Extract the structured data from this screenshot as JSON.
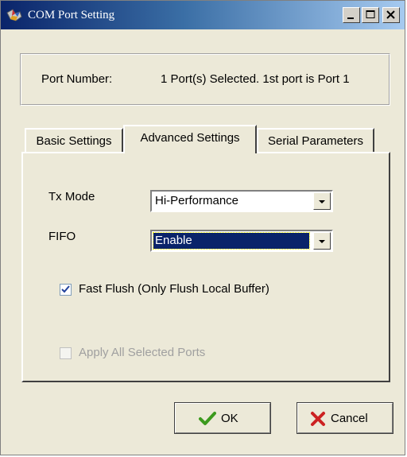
{
  "window": {
    "title": "COM Port Setting"
  },
  "port_info": {
    "label": "Port Number:",
    "value": "1 Port(s) Selected. 1st port is Port 1"
  },
  "tabs": [
    {
      "label": "Basic Settings",
      "active": false
    },
    {
      "label": "Advanced Settings",
      "active": true
    },
    {
      "label": "Serial Parameters",
      "active": false
    }
  ],
  "advanced": {
    "tx_mode": {
      "label": "Tx Mode",
      "value": "Hi-Performance"
    },
    "fifo": {
      "label": "FIFO",
      "value": "Enable"
    },
    "fast_flush": {
      "label": "Fast Flush (Only Flush Local Buffer)",
      "checked": true
    },
    "apply_all": {
      "label": "Apply All Selected Ports",
      "checked": false,
      "enabled": false
    }
  },
  "buttons": {
    "ok": "OK",
    "cancel": "Cancel"
  },
  "colors": {
    "title_start": "#0a246a",
    "title_end": "#a6caf0",
    "face": "#ece9d8",
    "selection": "#0a246a",
    "ok_check": "#3c9a1e",
    "cancel_x": "#cc2222"
  }
}
